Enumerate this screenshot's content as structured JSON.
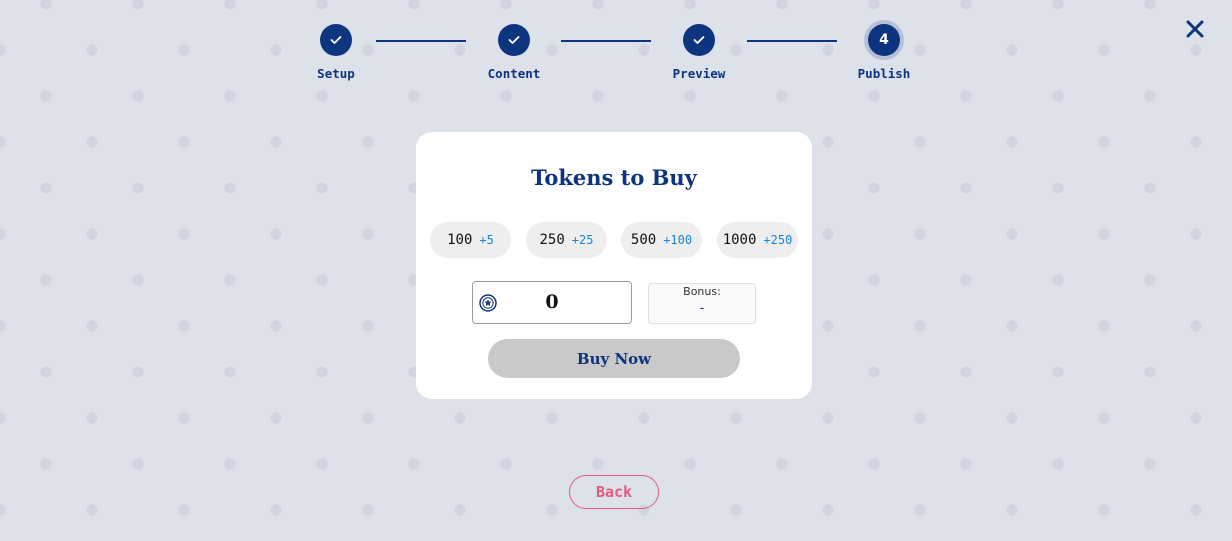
{
  "steps": [
    {
      "label": "Setup",
      "status": "completed",
      "icon": "check-icon"
    },
    {
      "label": "Content",
      "status": "completed",
      "icon": "check-icon"
    },
    {
      "label": "Preview",
      "status": "completed",
      "icon": "check-icon"
    },
    {
      "label": "Publish",
      "status": "current",
      "number": "4"
    }
  ],
  "close_icon": "close-icon",
  "card": {
    "title": "Tokens to Buy",
    "packages": [
      {
        "amount": "100",
        "bonus": "+5"
      },
      {
        "amount": "250",
        "bonus": "+25"
      },
      {
        "amount": "500",
        "bonus": "+100"
      },
      {
        "amount": "1000",
        "bonus": "+250"
      }
    ],
    "token_input": {
      "value": "0",
      "icon": "token-coin-icon"
    },
    "bonus": {
      "label": "Bonus:",
      "value": "-"
    },
    "buy_label": "Buy Now"
  },
  "back_label": "Back",
  "colors": {
    "primary": "#0d347e",
    "background": "#dde1ea",
    "bonus_text": "#1c84d6",
    "back_accent": "#e5597c",
    "disabled_button": "#c9c9c9"
  }
}
